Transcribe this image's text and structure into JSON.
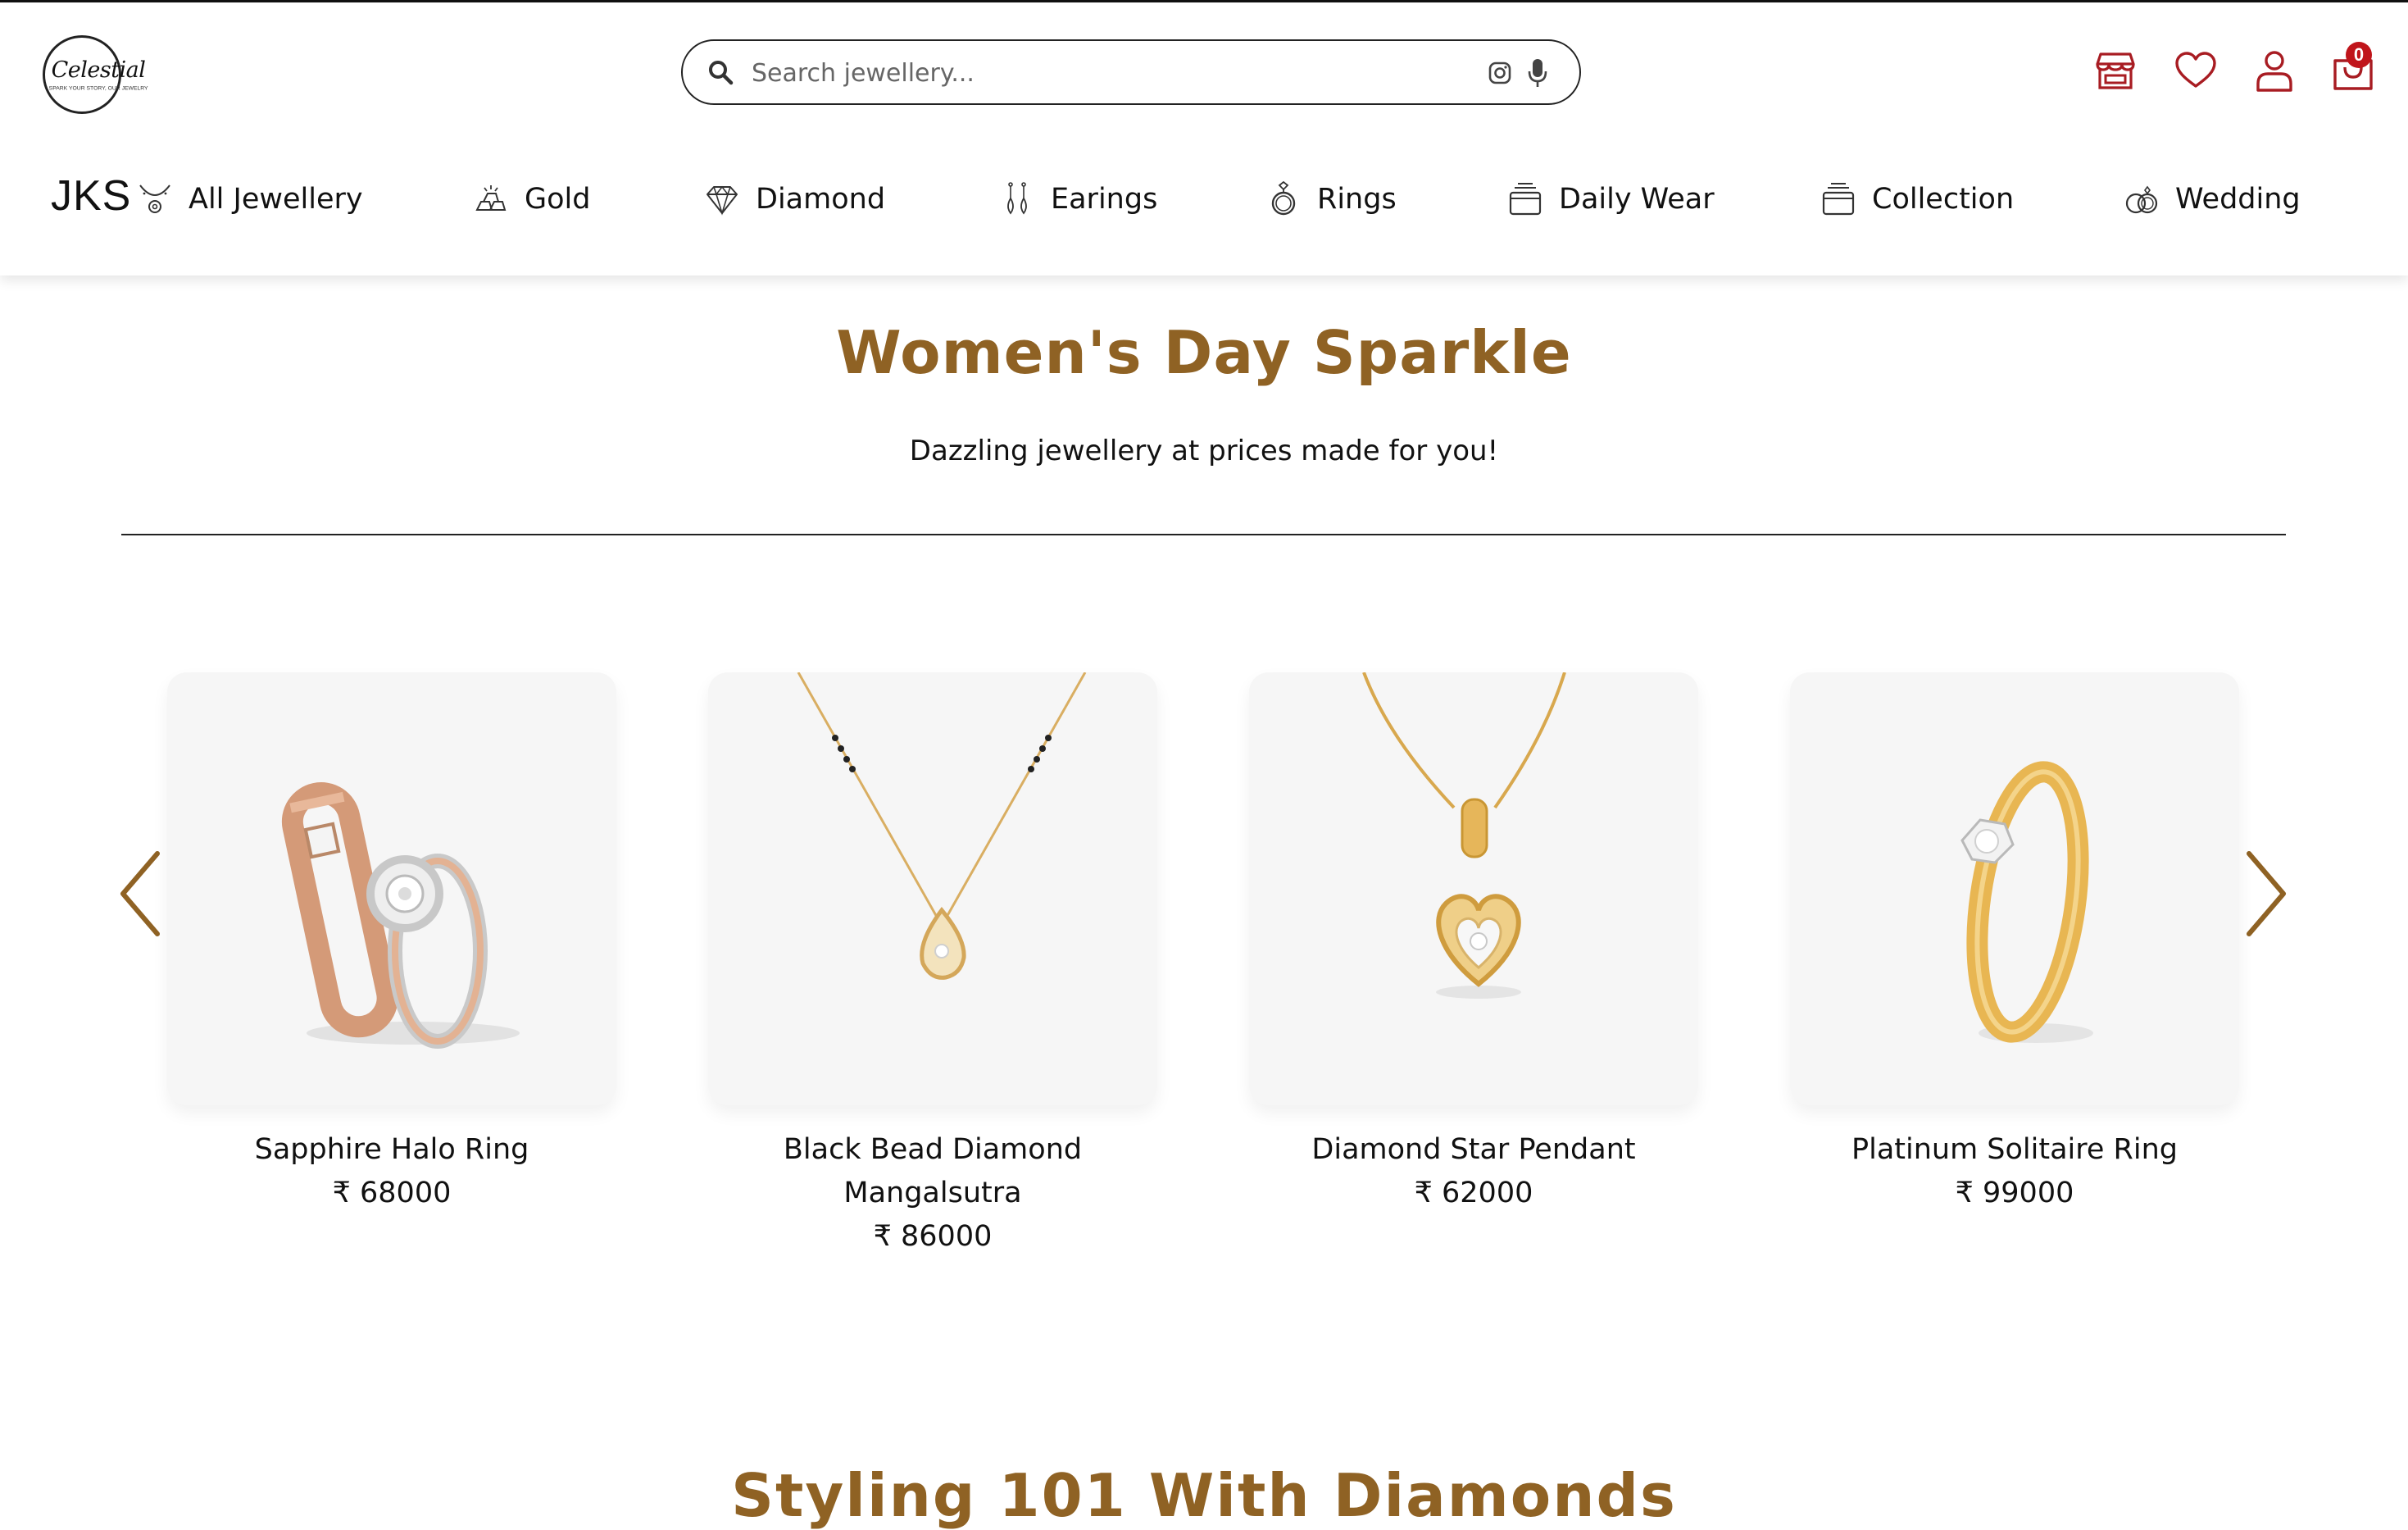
{
  "header": {
    "logo": {
      "script": "Celestial",
      "tagline": "SPARK YOUR STORY, OUR JEWELRY"
    },
    "search": {
      "placeholder": "Search jewellery..."
    },
    "icons": [
      "store-icon",
      "heart-icon",
      "user-icon",
      "cart-icon"
    ],
    "cart_count": "0"
  },
  "nav": {
    "brand": "JKS",
    "items": [
      {
        "label": "All Jewellery",
        "icon": "necklace-icon"
      },
      {
        "label": "Gold",
        "icon": "gold-bars-icon"
      },
      {
        "label": "Diamond",
        "icon": "diamond-icon"
      },
      {
        "label": "Earings",
        "icon": "earrings-icon"
      },
      {
        "label": "Rings",
        "icon": "ring-icon"
      },
      {
        "label": "Daily Wear",
        "icon": "box-icon"
      },
      {
        "label": "Collection",
        "icon": "box-icon"
      },
      {
        "label": "Wedding",
        "icon": "wedding-rings-icon"
      }
    ]
  },
  "hero": {
    "title": "Women's Day Sparkle",
    "subtitle": "Dazzling jewellery at prices made for you!"
  },
  "products": [
    {
      "name": "Sapphire Halo Ring",
      "price": "₹ 68000"
    },
    {
      "name_line1": "Black Bead Diamond",
      "name_line2": "Mangalsutra",
      "price": "₹ 86000"
    },
    {
      "name": "Diamond Star Pendant",
      "price": "₹ 62000"
    },
    {
      "name": "Platinum Solitaire Ring",
      "price": "₹ 99000"
    }
  ],
  "next_section": {
    "title": "Styling 101 With Diamonds"
  },
  "colors": {
    "accent": "#8f6224",
    "badge": "#c0151b",
    "icon_red": "#a81c22",
    "card_bg": "#f6f6f6"
  }
}
